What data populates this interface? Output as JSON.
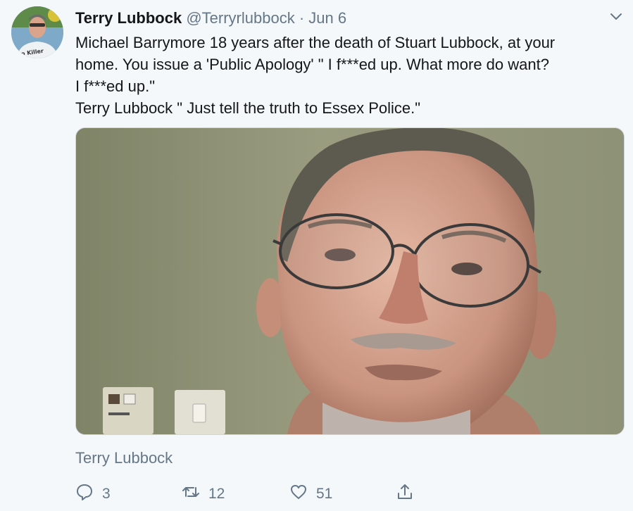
{
  "tweet": {
    "author_name": "Terry Lubbock",
    "handle": "@Terryrlubbock",
    "separator": "·",
    "date": "Jun 6",
    "text_lines": [
      "Michael Barrymore 18 years after the death of Stuart Lubbock, at your",
      "home. You issue a 'Public Apology' \" I f***ed up. What more do want?",
      " I f***ed up.\"",
      "Terry Lubbock \" Just tell the truth to Essex Police.\""
    ],
    "media_caption": "Terry Lubbock",
    "avatar_shirt_text": "o Killer"
  },
  "actions": {
    "replies": "3",
    "retweets": "12",
    "likes": "51"
  },
  "icons": {
    "caret": "chevron-down-icon",
    "reply": "reply-icon",
    "retweet": "retweet-icon",
    "like": "heart-icon",
    "share": "share-icon"
  },
  "colors": {
    "background": "#f5f8fa",
    "text": "#14171a",
    "secondary": "#657786",
    "border": "#ccd6dd"
  }
}
